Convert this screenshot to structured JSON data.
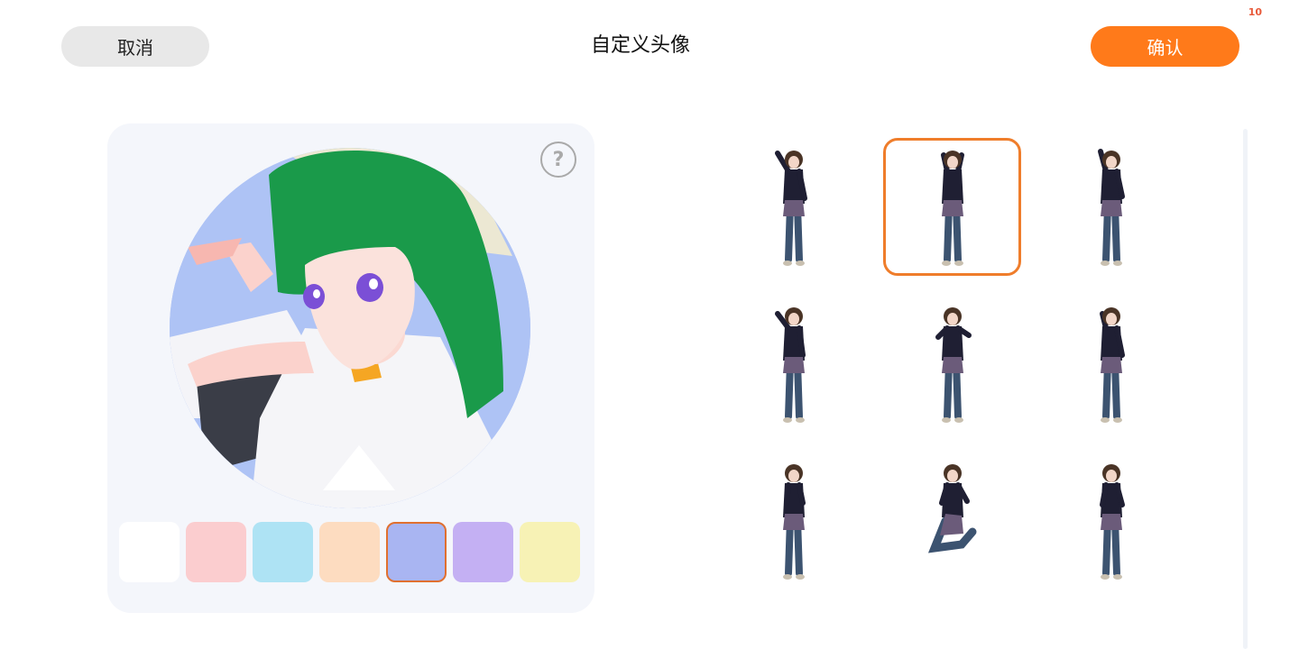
{
  "header": {
    "cancel_label": "取消",
    "title": "自定义头像",
    "confirm_label": "确认",
    "corner_count": "10"
  },
  "preview": {
    "help_symbol": "?",
    "help_icon": "question-circle-icon",
    "background_color": "#aec3f5"
  },
  "colors": {
    "accent": "#ff7a1a",
    "swatches": [
      "#ffffff",
      "#fbcdcf",
      "#aee3f4",
      "#fddcc0",
      "#a9b5f2",
      "#c4b0f3",
      "#f7f2b5",
      "#aef0dd"
    ],
    "selected_swatch_index": 4
  },
  "poses": {
    "count": 9,
    "selected_index": 1,
    "items": [
      "pose-1",
      "pose-2",
      "pose-3",
      "pose-4",
      "pose-5",
      "pose-6",
      "pose-7",
      "pose-8",
      "pose-9"
    ]
  }
}
